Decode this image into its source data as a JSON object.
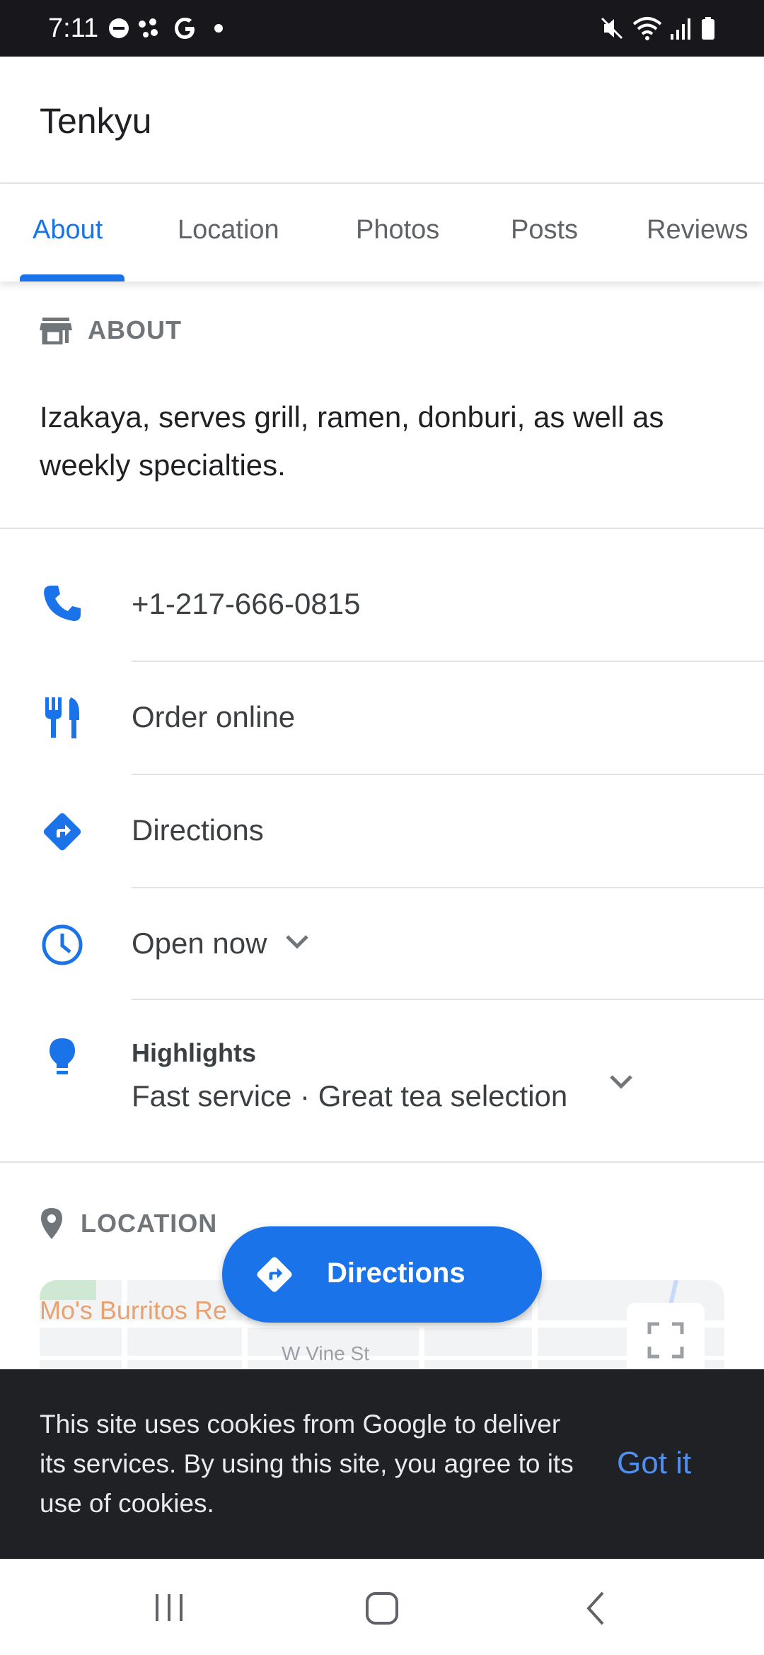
{
  "status_bar": {
    "time": "7:11"
  },
  "header": {
    "title": "Tenkyu"
  },
  "tabs": [
    {
      "label": "About",
      "active": true
    },
    {
      "label": "Location",
      "active": false
    },
    {
      "label": "Photos",
      "active": false
    },
    {
      "label": "Posts",
      "active": false
    },
    {
      "label": "Reviews",
      "active": false
    }
  ],
  "about": {
    "heading": "ABOUT",
    "description": "Izakaya, serves grill, ramen, donburi, as well as weekly specialties."
  },
  "details": {
    "phone": "+1-217-666-0815",
    "order": "Order online",
    "directions": "Directions",
    "hours": "Open now",
    "highlights_title": "Highlights",
    "highlights_value": "Fast service · Great tea selection"
  },
  "location": {
    "heading": "LOCATION",
    "map_label": "Mo's Burritos Re",
    "map_street": "W Vine St"
  },
  "fab": {
    "label": "Directions"
  },
  "cookie_banner": {
    "text": "This site uses cookies from Google to deliver its services. By using this site, you agree to its use of cookies.",
    "button": "Got it"
  },
  "colors": {
    "accent": "#1a73e8",
    "banner_bg": "#202124"
  }
}
